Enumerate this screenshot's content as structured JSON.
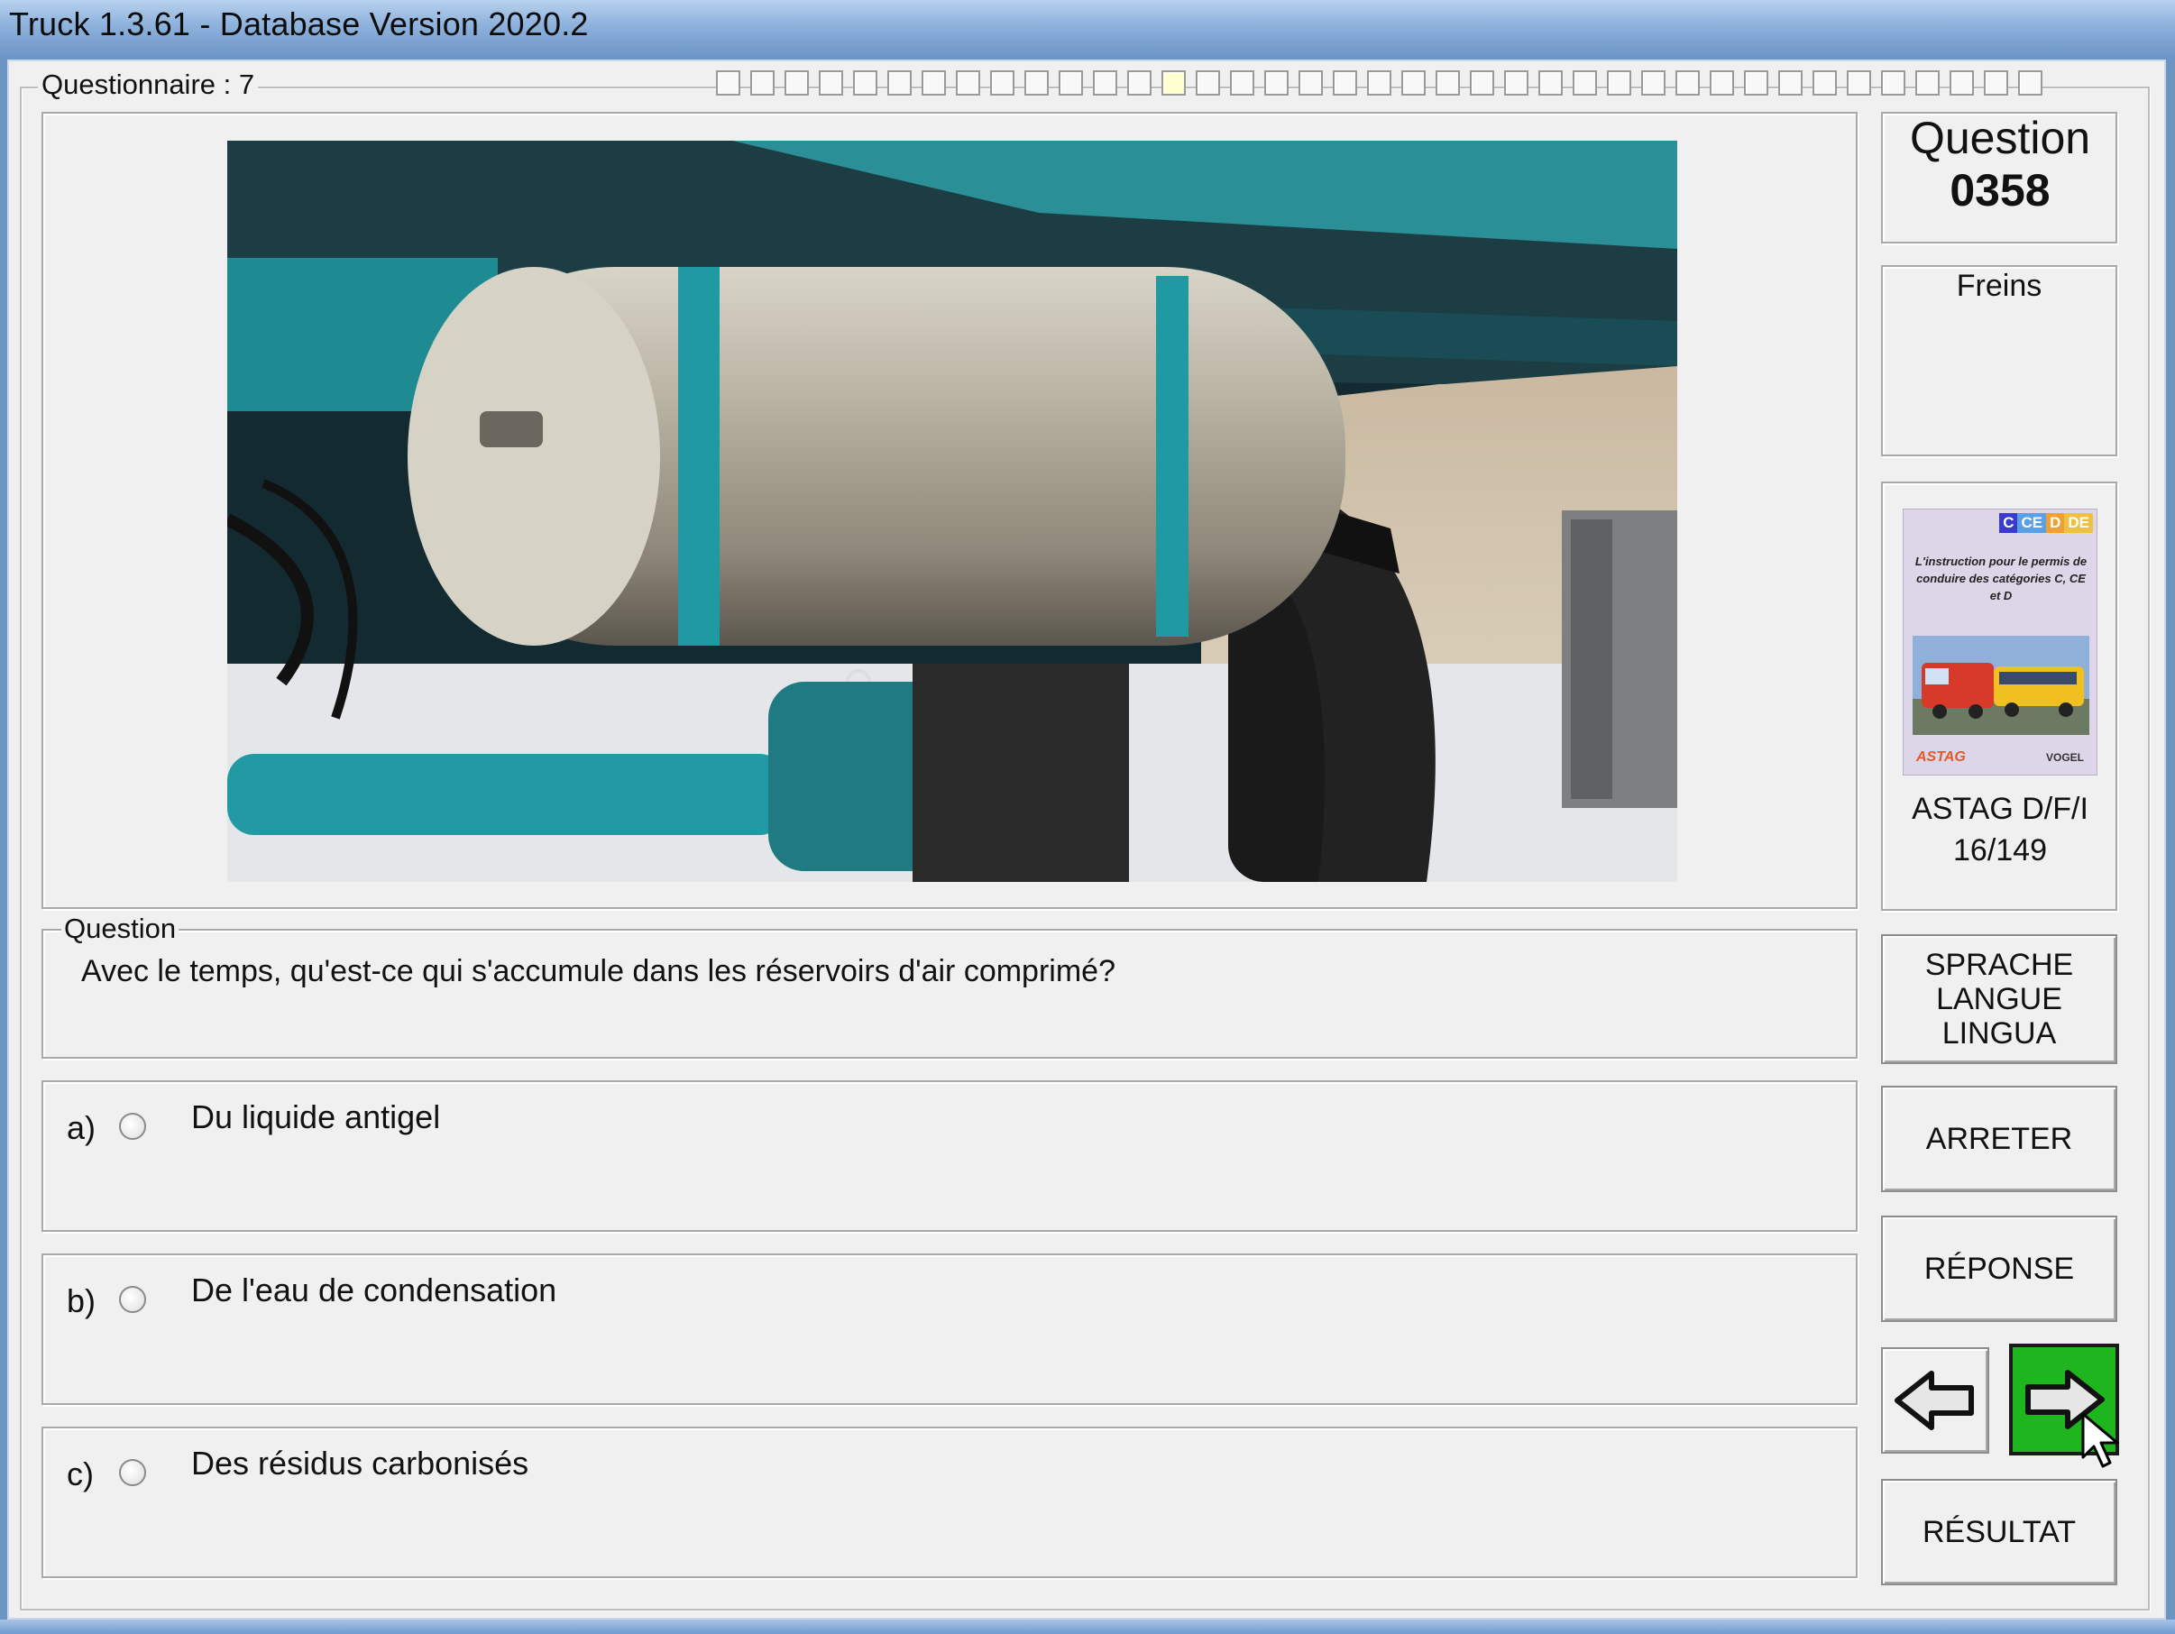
{
  "window": {
    "title": "Truck 1.3.61 - Database Version 2020.2"
  },
  "questionnaire": {
    "label": "Questionnaire : 7",
    "progress_total": 39,
    "progress_current": 13
  },
  "question": {
    "group_label": "Question",
    "text": "Avec le temps, qu'est-ce qui s'accumule dans les réservoirs d'air comprimé?"
  },
  "answers": [
    {
      "letter": "a)",
      "text": "Du liquide antigel",
      "selected": false
    },
    {
      "letter": "b)",
      "text": "De l'eau de condensation",
      "selected": false
    },
    {
      "letter": "c)",
      "text": "Des résidus carbonisés",
      "selected": false
    }
  ],
  "sidebar": {
    "question_label": "Question",
    "question_number": "0358",
    "category": "Freins",
    "book": {
      "tags": [
        "C",
        "CE",
        "D",
        "DE"
      ],
      "blurb": "L'instruction pour le permis de conduire des catégories C, CE et D",
      "logo_left": "ASTAG",
      "logo_right": "VOGEL",
      "caption_line1": "ASTAG D/F/I",
      "caption_line2": "16/149"
    },
    "buttons": {
      "language_line1": "SPRACHE",
      "language_line2": "LANGUE",
      "language_line3": "LINGUA",
      "stop": "ARRETER",
      "answer": "RÉPONSE",
      "result": "RÉSULTAT"
    }
  },
  "colors": {
    "next_button_fill": "#1fb51f",
    "tank_band": "#1f9aa2",
    "chassis": "#1f8f96"
  },
  "icons": {
    "prev": "arrow-left-icon",
    "next": "arrow-right-icon",
    "cursor": "mouse-pointer-icon"
  }
}
